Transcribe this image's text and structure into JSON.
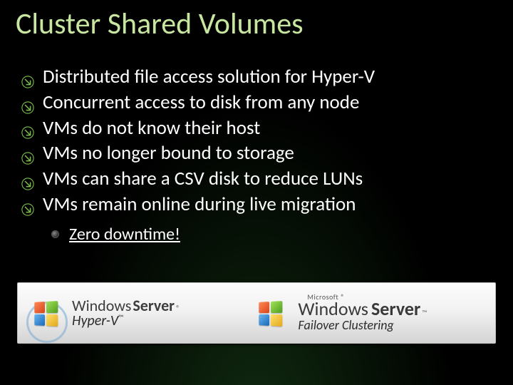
{
  "title": "Cluster Shared Volumes",
  "bullets": [
    "Distributed file access solution for Hyper-V",
    "Concurrent access to disk from any node",
    "VMs do not know their host",
    "VMs no longer bound to storage",
    "VMs can share a CSV disk to reduce LUNs",
    "VMs remain online during live migration"
  ],
  "sub_bullet": "Zero downtime!",
  "logo_bar": {
    "left": {
      "brand_light": "Windows",
      "brand_bold": "Server",
      "reg": "®",
      "family": "Hyper-V",
      "tm": "™"
    },
    "right": {
      "ms": "Microsoft",
      "reg": "®",
      "brand_light": "Windows",
      "brand_bold": "Server",
      "family": "Failover Clustering"
    }
  }
}
